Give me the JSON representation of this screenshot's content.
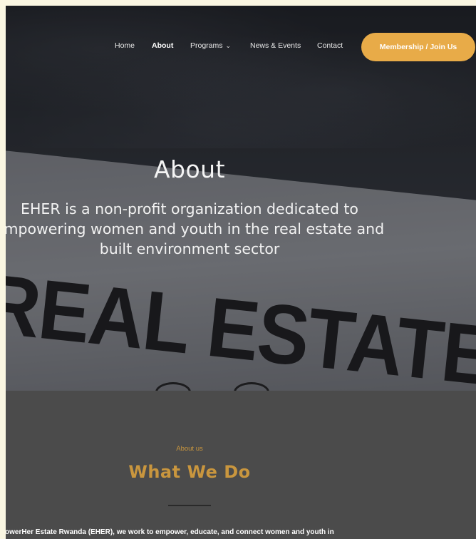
{
  "nav": {
    "items": [
      {
        "label": "Home"
      },
      {
        "label": "About"
      },
      {
        "label": "Programs"
      },
      {
        "label": "News & Events"
      },
      {
        "label": "Contact"
      }
    ],
    "active": "About",
    "join_label": "Membership / Join Us"
  },
  "hero": {
    "title": "About",
    "description": "EHER is a non-profit organization dedicated to empowering women and youth in the real estate and built environment sector",
    "sign_text": "REAL ESTATE"
  },
  "about": {
    "eyebrow": "About us",
    "title": "What We Do",
    "body": "mpowerHer Estate Rwanda (EHER), we work to empower, educate, and connect women and youth in"
  },
  "colors": {
    "accent": "#e8ab48",
    "accent_text": "#c9963e",
    "section_bg": "#4b4b4b",
    "page_bg": "#faf6e2"
  },
  "icons": {
    "programs_dropdown": "chevron-down-icon"
  }
}
